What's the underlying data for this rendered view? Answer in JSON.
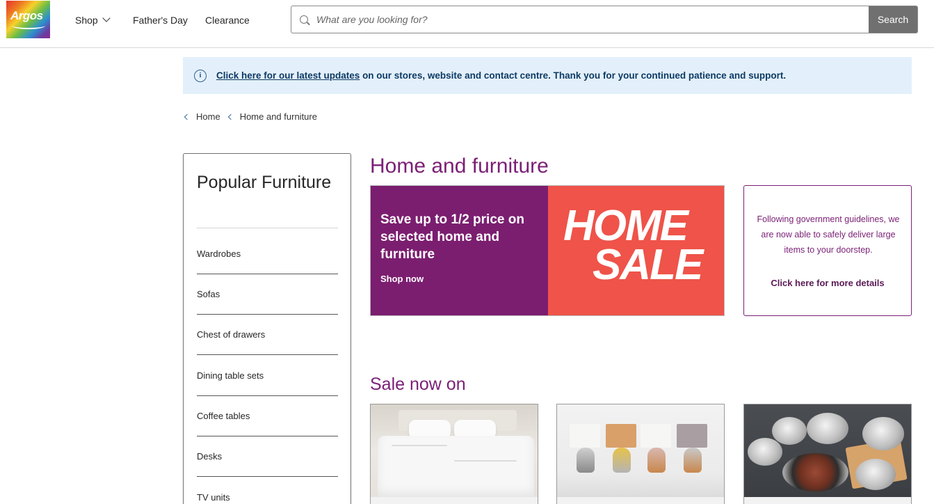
{
  "header": {
    "logo_text": "Argos",
    "nav": [
      {
        "label": "Shop"
      },
      {
        "label": "Father's Day"
      },
      {
        "label": "Clearance"
      }
    ],
    "search": {
      "placeholder": "What are you looking for?",
      "button_label": "Search"
    }
  },
  "banner": {
    "link_text": "Click here for our latest updates",
    "rest_text": " on our stores, website and contact centre. Thank you for your continued patience and support."
  },
  "breadcrumb": [
    "Home",
    "Home and furniture"
  ],
  "sidebar": {
    "title": "Popular Furniture",
    "items": [
      {
        "label": "Wardrobes"
      },
      {
        "label": "Sofas"
      },
      {
        "label": "Chest of drawers"
      },
      {
        "label": "Dining table sets"
      },
      {
        "label": "Coffee tables"
      },
      {
        "label": "Desks"
      },
      {
        "label": "TV units"
      }
    ]
  },
  "main": {
    "title": "Home and furniture",
    "promo": {
      "headline": "Save up to 1/2 price on selected home and furniture",
      "cta": "Shop now",
      "big_line1": "HOME",
      "big_line2": "SALE"
    },
    "notice": {
      "text": "Following government guidelines, we are now able to safely deliver large items to your doorstep.",
      "link": "Click here for more details"
    },
    "sale_title": "Sale now on"
  },
  "colors": {
    "brand_purple": "#7b1f76",
    "promo_red": "#ef5349",
    "banner_bg": "#e3f0fb",
    "search_button": "#707070"
  }
}
